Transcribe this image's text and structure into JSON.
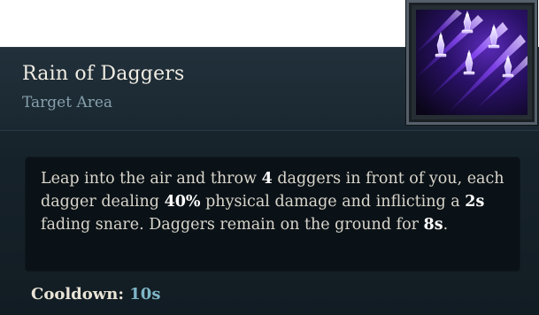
{
  "ability": {
    "name": "Rain of Daggers",
    "type": "Target Area",
    "icon": "daggers-icon",
    "description": {
      "p1": "Leap into the air and throw ",
      "daggers": "4",
      "p2": " daggers in front of you, each dagger dealing ",
      "damage": "40%",
      "p3": " physical damage and inflicting a ",
      "snare": "2s",
      "p4": " fading snare. Daggers remain on the ground for ",
      "duration": "8s",
      "p5": "."
    },
    "cooldown_label": "Cooldown:",
    "cooldown_value": "10s"
  },
  "colors": {
    "accent": "#7fb6c7",
    "icon_purple": "#8a3dff"
  }
}
